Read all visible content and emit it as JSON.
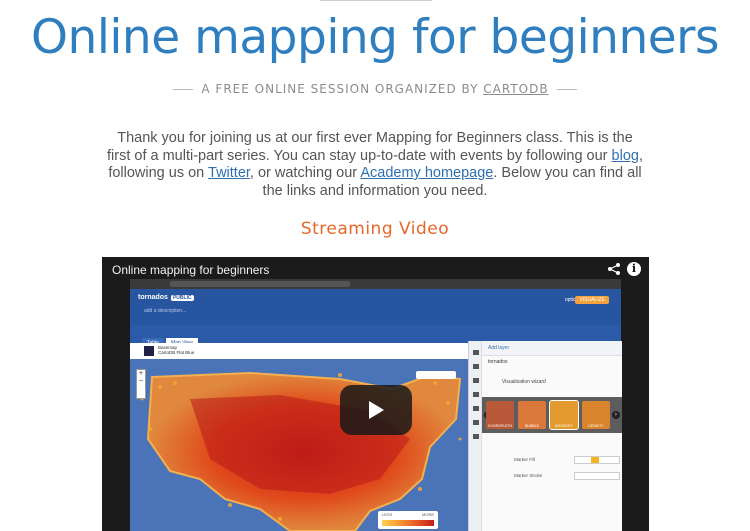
{
  "header": {
    "title": "Online mapping for beginners",
    "subtitle_prefix": "A FREE ONLINE SESSION ORGANIZED BY",
    "subtitle_link": "CARTODB"
  },
  "intro": {
    "part1": "Thank you for joining us at our first ever Mapping for Beginners class. This is the first of a multi-part series. You can stay up-to-date with events by following our ",
    "blog_link": "blog",
    "part2": ", following us on ",
    "twitter_link": "Twitter",
    "part3": ", or watching our ",
    "academy_link": "Academy homepage",
    "part4": ". Below you can find all the links and information you need."
  },
  "section": {
    "title": "Streaming Video"
  },
  "video": {
    "title": "Online mapping for beginners",
    "info_glyph": "i",
    "app": {
      "table_name": "tornados",
      "table_badge": "PUBLIC",
      "description": "add a description...",
      "options_label": "options",
      "visualize_label": "VISUALIZE",
      "tabs": [
        "Table",
        "Map View"
      ],
      "basemap_title": "Basemap",
      "basemap_name": "CartoDB Flat Blue",
      "zoom_in": "+",
      "zoom_out": "−",
      "legend_low": "LESS",
      "legend_high": "MORE",
      "panel": {
        "add_layer": "Add layer",
        "layer_name": "tornados",
        "wizard_title": "Visualization wizard",
        "thumbs": [
          "CHOROPLETH",
          "BUBBLE",
          "INTENSITY",
          "DENSITY"
        ],
        "prop1": "Marker Fill",
        "prop2": "Marker Stroke"
      }
    }
  },
  "colors": {
    "title_blue": "#2f7fc0",
    "accent_orange": "#e8662a",
    "link_blue": "#2f6fb0"
  }
}
